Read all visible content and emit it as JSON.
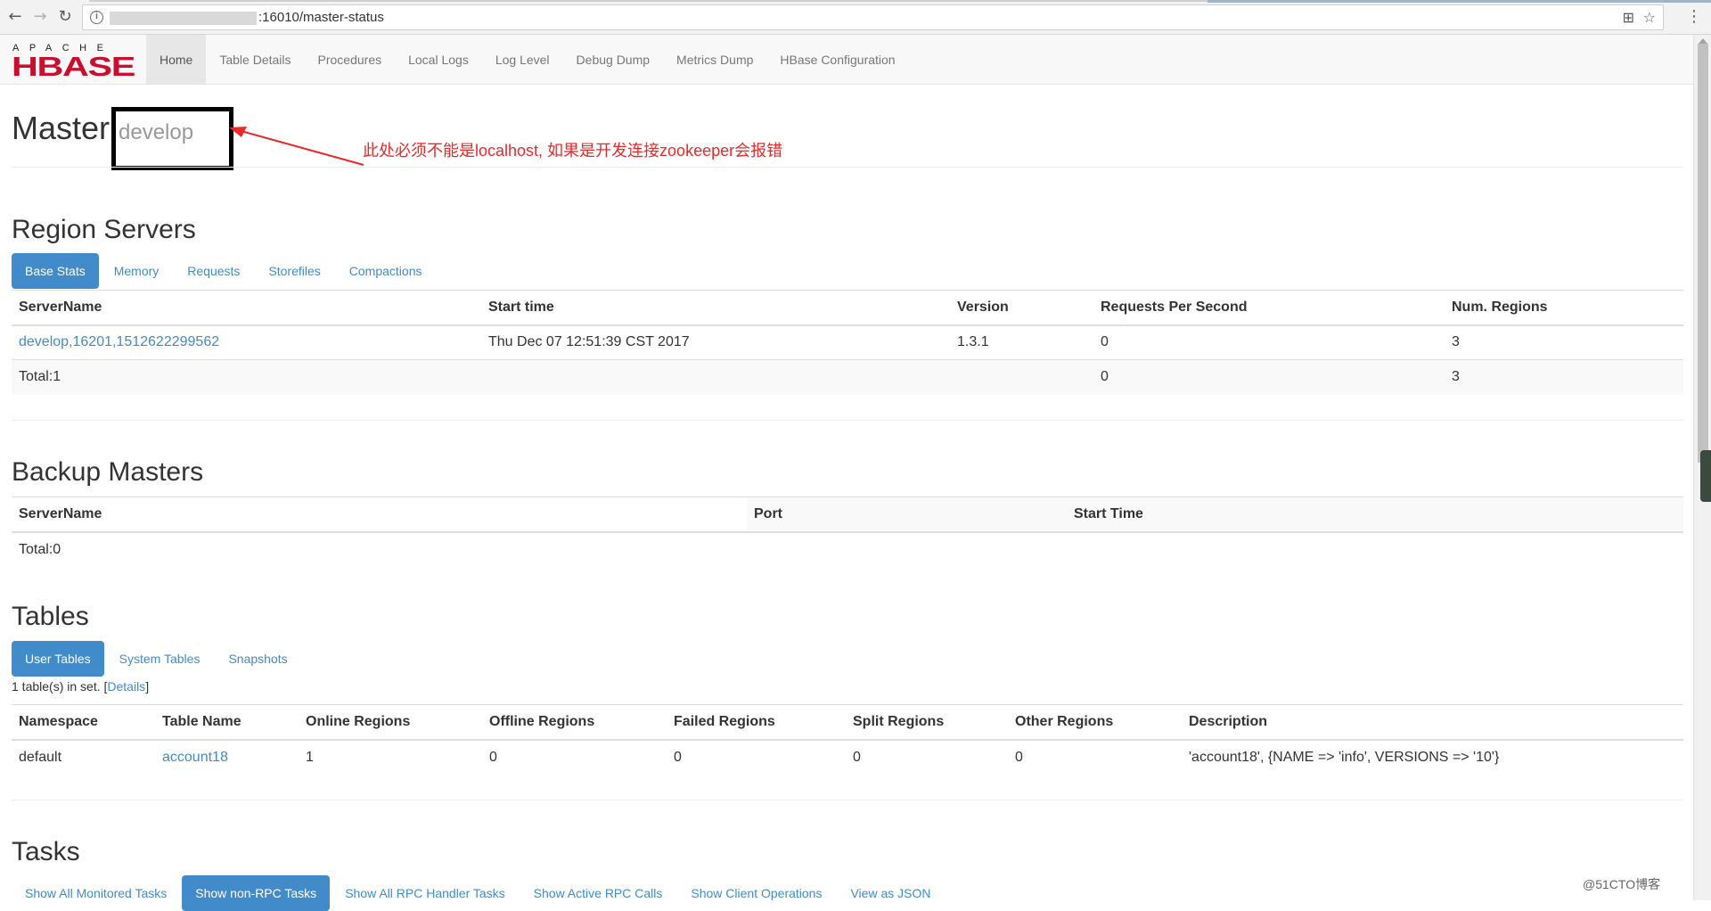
{
  "browser": {
    "url": ":16010/master-status"
  },
  "nav": {
    "items": [
      "Home",
      "Table Details",
      "Procedures",
      "Local Logs",
      "Log Level",
      "Debug Dump",
      "Metrics Dump",
      "HBase Configuration"
    ]
  },
  "master": {
    "title": "Master",
    "hostname": "develop",
    "annotation": "此处必须不能是localhost, 如果是开发连接zookeeper会报错"
  },
  "region_servers": {
    "title": "Region Servers",
    "tabs": [
      "Base Stats",
      "Memory",
      "Requests",
      "Storefiles",
      "Compactions"
    ],
    "columns": [
      "ServerName",
      "Start time",
      "Version",
      "Requests Per Second",
      "Num. Regions"
    ],
    "rows": [
      [
        "develop,16201,1512622299562",
        "Thu Dec 07 12:51:39 CST 2017",
        "1.3.1",
        "0",
        "3"
      ]
    ],
    "total": [
      "Total:1",
      "",
      "",
      "0",
      "3"
    ]
  },
  "backup_masters": {
    "title": "Backup Masters",
    "columns": [
      "ServerName",
      "Port",
      "Start Time"
    ],
    "total": "Total:0"
  },
  "tables": {
    "title": "Tables",
    "tabs": [
      "User Tables",
      "System Tables",
      "Snapshots"
    ],
    "count_prefix": "1 table(s) in set. [",
    "details_link": "Details",
    "count_suffix": "]",
    "columns": [
      "Namespace",
      "Table Name",
      "Online Regions",
      "Offline Regions",
      "Failed Regions",
      "Split Regions",
      "Other Regions",
      "Description"
    ],
    "rows": [
      [
        "default",
        "account18",
        "1",
        "0",
        "0",
        "0",
        "0",
        "'account18', {NAME => 'info', VERSIONS => '10'}"
      ]
    ]
  },
  "tasks": {
    "title": "Tasks",
    "tabs": [
      "Show All Monitored Tasks",
      "Show non-RPC Tasks",
      "Show All RPC Handler Tasks",
      "Show Active RPC Calls",
      "Show Client Operations",
      "View as JSON"
    ]
  },
  "watermark": "@51CTO博客",
  "colors": {
    "accent": "#428bca",
    "annotation": "#e82a2a",
    "logo_red": "#c8102e"
  }
}
